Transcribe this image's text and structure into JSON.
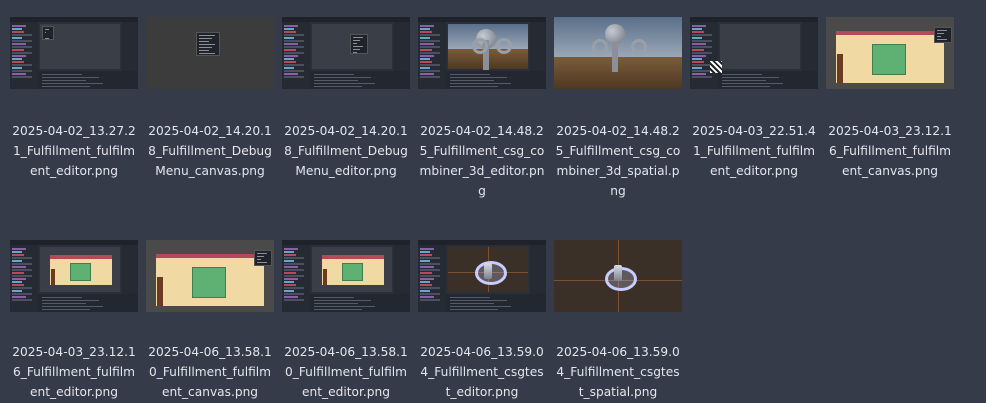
{
  "files": [
    {
      "name": "2025-04-02_13.27.21_Fulfillment_fulfillment_editor.png",
      "kind": "editor-empty"
    },
    {
      "name": "2025-04-02_14.20.18_Fulfillment_DebugMenu_canvas.png",
      "kind": "canvas-debug"
    },
    {
      "name": "2025-04-02_14.20.18_Fulfillment_DebugMenu_editor.png",
      "kind": "editor-debug"
    },
    {
      "name": "2025-04-02_14.48.25_Fulfillment_csg_combiner_3d_editor.png",
      "kind": "editor-3d"
    },
    {
      "name": "2025-04-02_14.48.25_Fulfillment_csg_combiner_3d_spatial.png",
      "kind": "spatial-3d"
    },
    {
      "name": "2025-04-03_22.51.41_Fulfillment_fulfillment_editor.png",
      "kind": "editor-qr"
    },
    {
      "name": "2025-04-03_23.12.16_Fulfillment_fulfillment_canvas.png",
      "kind": "canvas-room"
    },
    {
      "name": "2025-04-03_23.12.16_Fulfillment_fulfillment_editor.png",
      "kind": "editor-room"
    },
    {
      "name": "2025-04-06_13.58.10_Fulfillment_fulfillment_canvas.png",
      "kind": "canvas-room"
    },
    {
      "name": "2025-04-06_13.58.10_Fulfillment_fulfillment_editor.png",
      "kind": "editor-room"
    },
    {
      "name": "2025-04-06_13.59.04_Fulfillment_csgtest_editor.png",
      "kind": "editor-csg"
    },
    {
      "name": "2025-04-06_13.59.04_Fulfillment_csgtest_spatial.png",
      "kind": "spatial-csg"
    }
  ],
  "labels": [
    "2025-04-02_13.27.2\n1_Fulfillment_fulfilm\nent_editor.png",
    "2025-04-02_14.20.1\n8_Fulfillment_Debug\nMenu_canvas.png",
    "2025-04-02_14.20.1\n8_Fulfillment_Debug\nMenu_editor.png",
    "2025-04-02_14.48.2\n5_Fulfillment_csg_co\nmbiner_3d_editor.pn\ng",
    "2025-04-02_14.48.2\n5_Fulfillment_csg_co\nmbiner_3d_spatial.p\nng",
    "2025-04-03_22.51.4\n1_Fulfillment_fulfilm\nent_editor.png",
    "2025-04-03_23.12.1\n6_Fulfillment_fulfilm\nent_canvas.png",
    "2025-04-03_23.12.1\n6_Fulfillment_fulfilm\nent_editor.png",
    "2025-04-06_13.58.1\n0_Fulfillment_fulfilm\nent_canvas.png",
    "2025-04-06_13.58.1\n0_Fulfillment_fulfilm\nent_editor.png",
    "2025-04-06_13.59.0\n4_Fulfillment_csgtes\nt_editor.png",
    "2025-04-06_13.59.0\n4_Fulfillment_csgtes\nt_spatial.png"
  ]
}
